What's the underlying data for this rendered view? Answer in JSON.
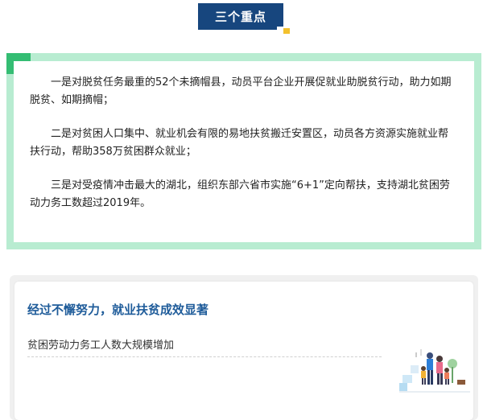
{
  "header": {
    "title": "三个重点"
  },
  "key_points": [
    "一是对脱贫任务最重的52个未摘帽县，动员平台企业开展促就业助脱贫行动，助力如期脱贫、如期摘帽；",
    "二是对贫困人口集中、就业机会有限的易地扶贫搬迁安置区，动员各方资源实施就业帮扶行动，帮助358万贫困群众就业；",
    "三是对受疫情冲击最大的湖北，组织东部六省市实施“6+1”定向帮扶，支持湖北贫困劳动力务工数超过2019年。"
  ],
  "card": {
    "title": "经过不懈努力，就业扶贫成效显著",
    "subtitle": "贫困劳动力务工人数大规模增加"
  },
  "colors": {
    "header_bg": "#17467e",
    "accent_yellow": "#f3c12d",
    "frame_green_light": "#b8ecd1",
    "frame_green_dark": "#34bd73",
    "card_title": "#1f5c9a"
  },
  "icons": {
    "illustration": "family-illustration-icon"
  }
}
